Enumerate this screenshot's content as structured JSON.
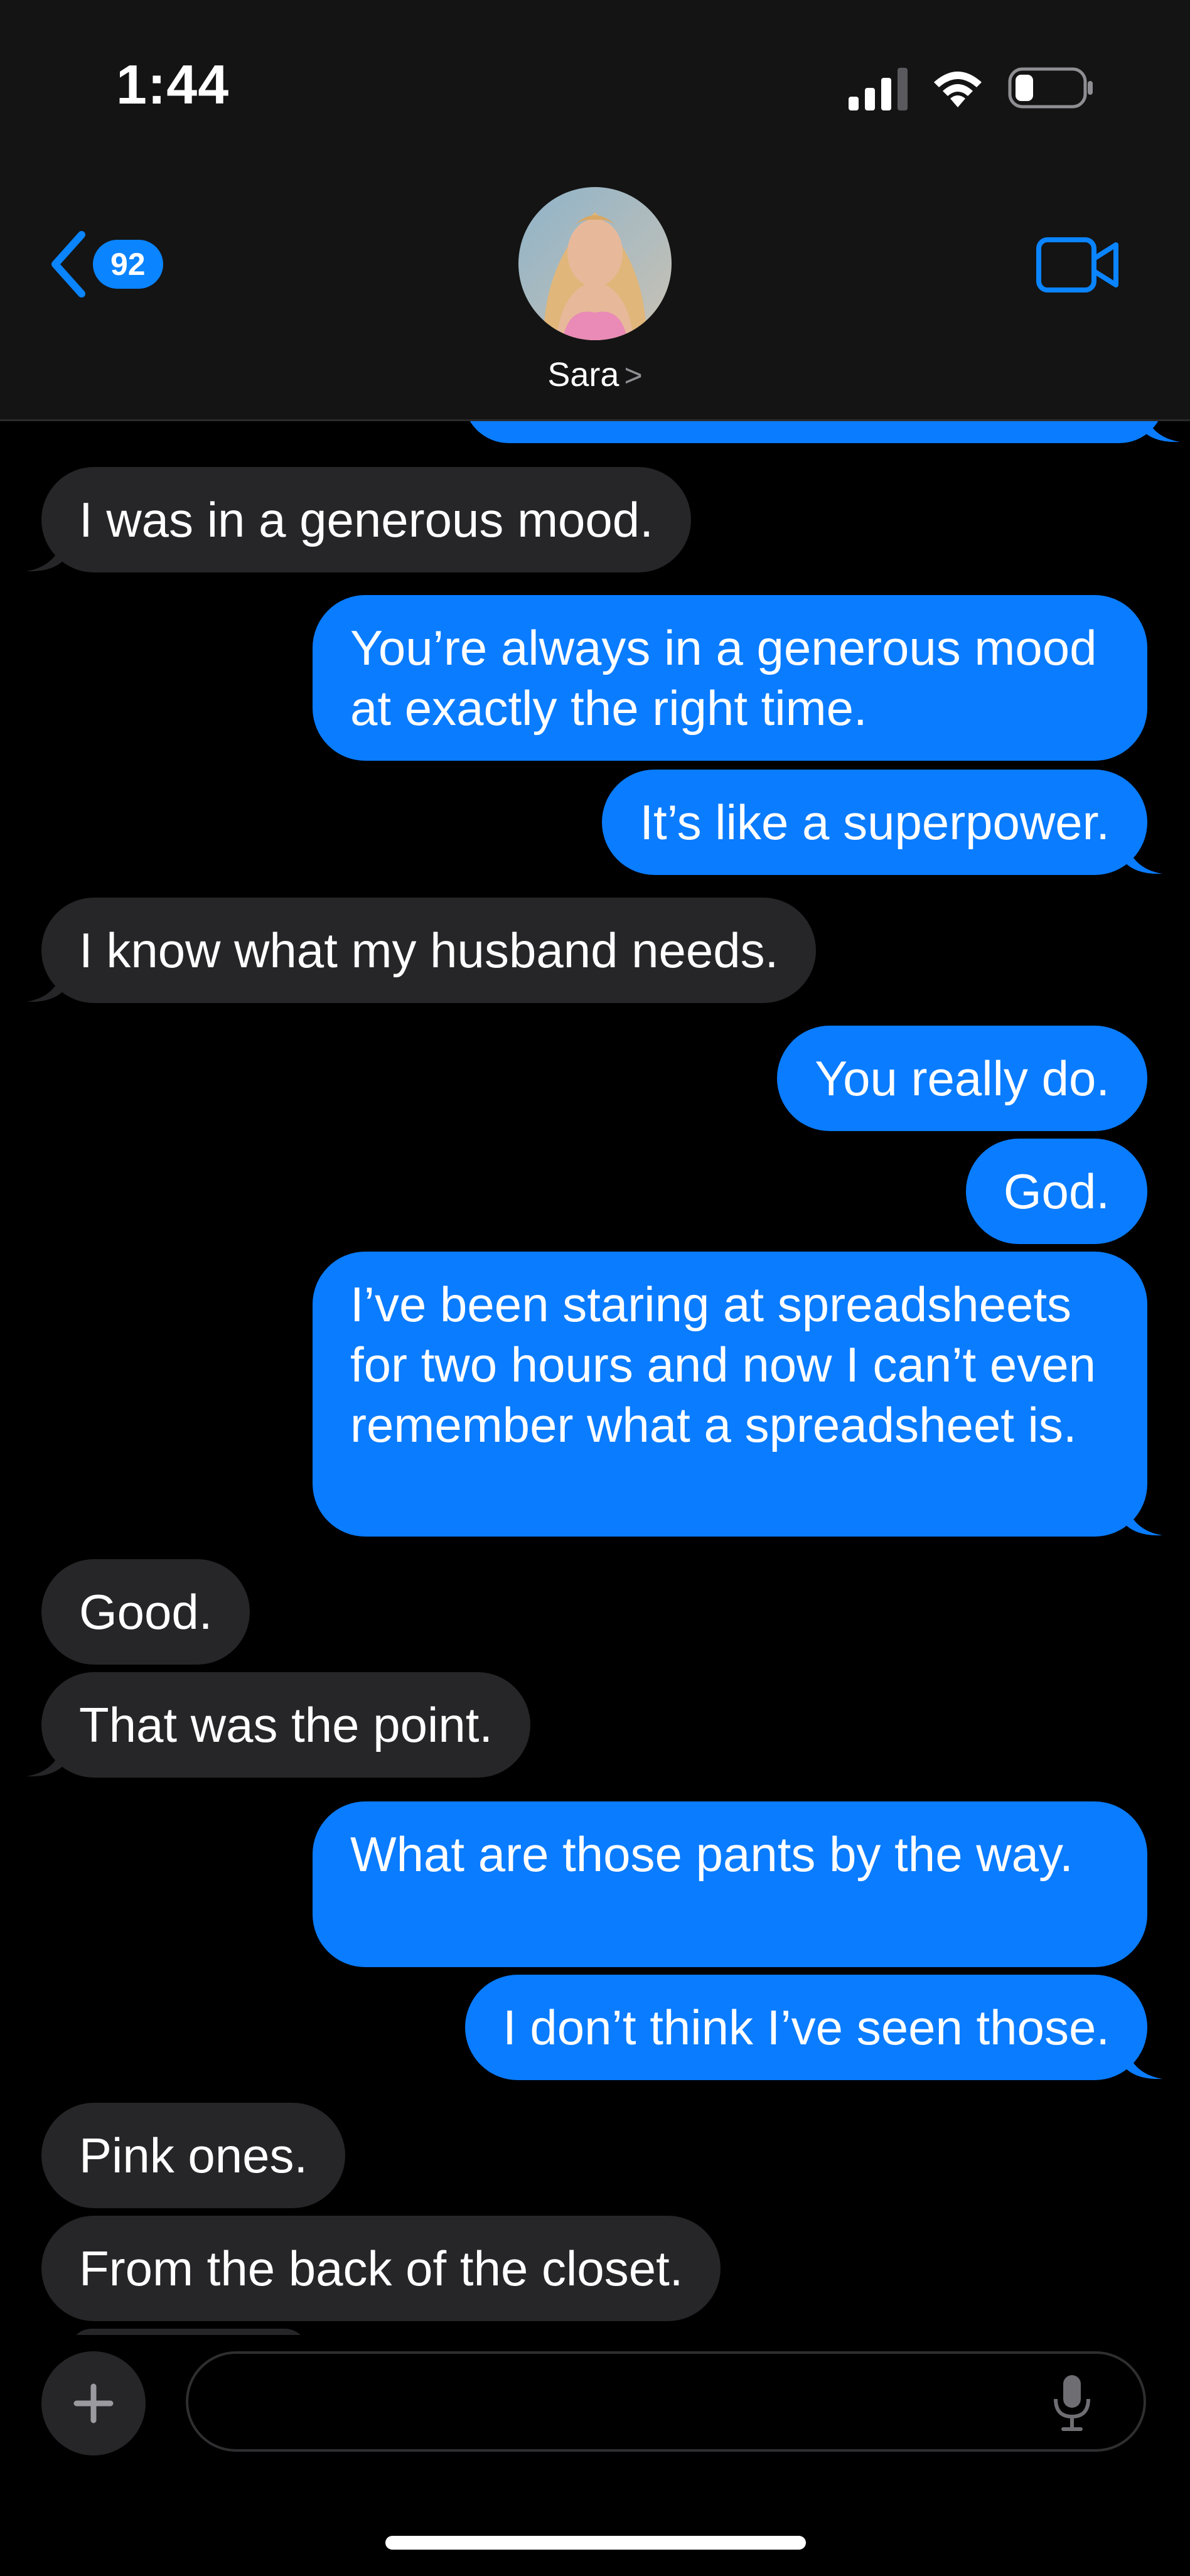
{
  "status_bar": {
    "time": "1:44"
  },
  "header": {
    "unread_count": "92",
    "contact_name": "Sara",
    "contact_chevron": ">"
  },
  "messages": [
    {
      "from": "me",
      "text": ""
    },
    {
      "from": "them",
      "text": "I was in a generous mood."
    },
    {
      "from": "me",
      "text": "You’re always in a generous mood at exactly the right time."
    },
    {
      "from": "me",
      "text": "It’s like a superpower."
    },
    {
      "from": "them",
      "text": "I know what my husband needs."
    },
    {
      "from": "me",
      "text": "You really do."
    },
    {
      "from": "me",
      "text": "God."
    },
    {
      "from": "me",
      "text": "I’ve been staring at spreadsheets for two hours and now I can’t even remember what a spreadsheet is."
    },
    {
      "from": "them",
      "text": "Good."
    },
    {
      "from": "them",
      "text": "That was the point."
    },
    {
      "from": "me",
      "text": "What are those pants by the way."
    },
    {
      "from": "me",
      "text": "I don’t think I’ve seen those."
    },
    {
      "from": "them",
      "text": "Pink ones."
    },
    {
      "from": "them",
      "text": "From the back of the closet."
    }
  ],
  "composer": {
    "placeholder": ""
  },
  "colors": {
    "outgoing_bubble": "#0a7cff",
    "incoming_bubble": "#262628",
    "accent": "#0a84ff",
    "header_background": "#141414"
  }
}
